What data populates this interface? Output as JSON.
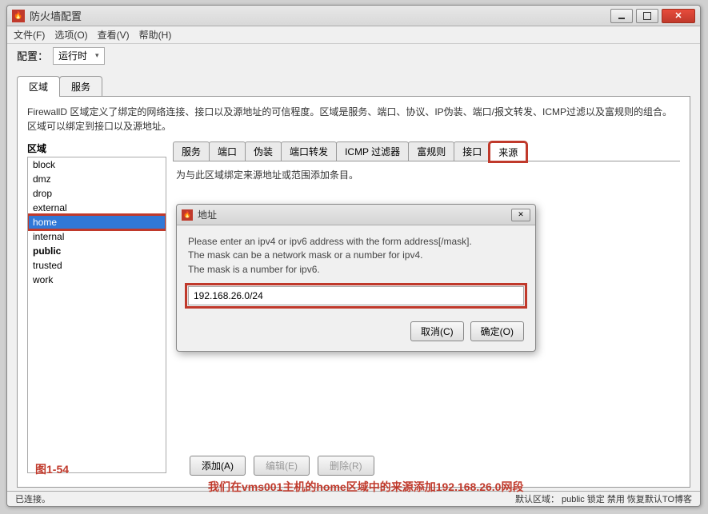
{
  "window": {
    "title": "防火墙配置"
  },
  "menu": {
    "file": "文件(F)",
    "options": "选项(O)",
    "view": "查看(V)",
    "help": "帮助(H)"
  },
  "toolbar": {
    "config_label": "配置：",
    "runtime_option": "运行时"
  },
  "outer_tabs": {
    "zone": "区域",
    "service": "服务"
  },
  "description": "FirewallD 区域定义了绑定的网络连接、接口以及源地址的可信程度。区域是服务、端口、协议、IP伪装、端口/报文转发、ICMP过滤以及富规则的组合。区域可以绑定到接口以及源地址。",
  "zones": {
    "title": "区域",
    "items": [
      "block",
      "dmz",
      "drop",
      "external",
      "home",
      "internal",
      "public",
      "trusted",
      "work"
    ],
    "selected_index": 4,
    "bold_index": 6
  },
  "inner_tabs": {
    "items": [
      "服务",
      "端口",
      "伪装",
      "端口转发",
      "ICMP 过滤器",
      "富规则",
      "接口",
      "来源"
    ],
    "active_index": 7
  },
  "hint": "为与此区域绑定来源地址或范围添加条目。",
  "dialog": {
    "title": "地址",
    "message": "Please enter an ipv4 or ipv6 address with the form address[/mask].\nThe mask can be a network mask or a number for ipv4.\nThe mask is a number for ipv6.",
    "input_value": "192.168.26.0/24",
    "cancel": "取消(C)",
    "ok": "确定(O)"
  },
  "annotation": "我们在vms001主机的home区域中的来源添加192.168.26.0网段",
  "figure_label": "图1-54",
  "bottom_buttons": {
    "add": "添加(A)",
    "edit": "编辑(E)",
    "delete": "删除(R)"
  },
  "status": {
    "left": "已连接。",
    "right": "默认区域： public 锁定 禁用 恢复默认TO博客"
  }
}
